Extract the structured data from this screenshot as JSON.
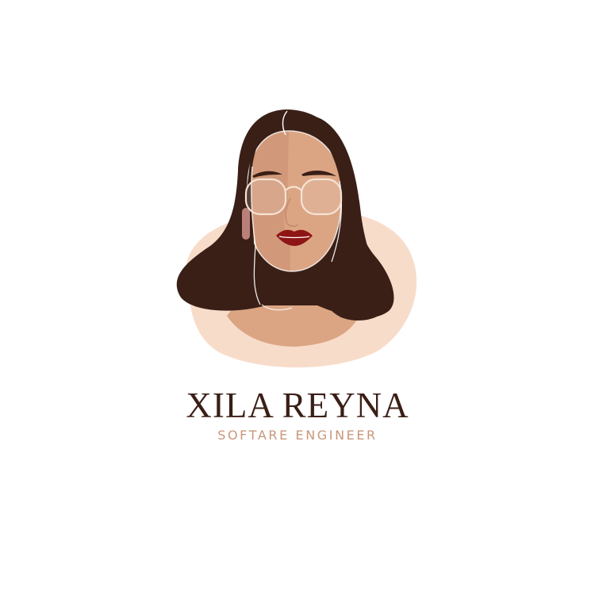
{
  "logo": {
    "name": "XILA REYNA",
    "title": "SOFTARE ENGINEER",
    "illustration": "woman-portrait-icon",
    "colors": {
      "background": "#ffffff",
      "backdrop": "#f8dcca",
      "hair": "#3a1f16",
      "skin": "#dba584",
      "skin_shadow": "#c98f72",
      "lips": "#8e1515",
      "glasses": "#f5e3d6",
      "name_text": "#3a1f16",
      "title_text": "#c9967a"
    }
  }
}
